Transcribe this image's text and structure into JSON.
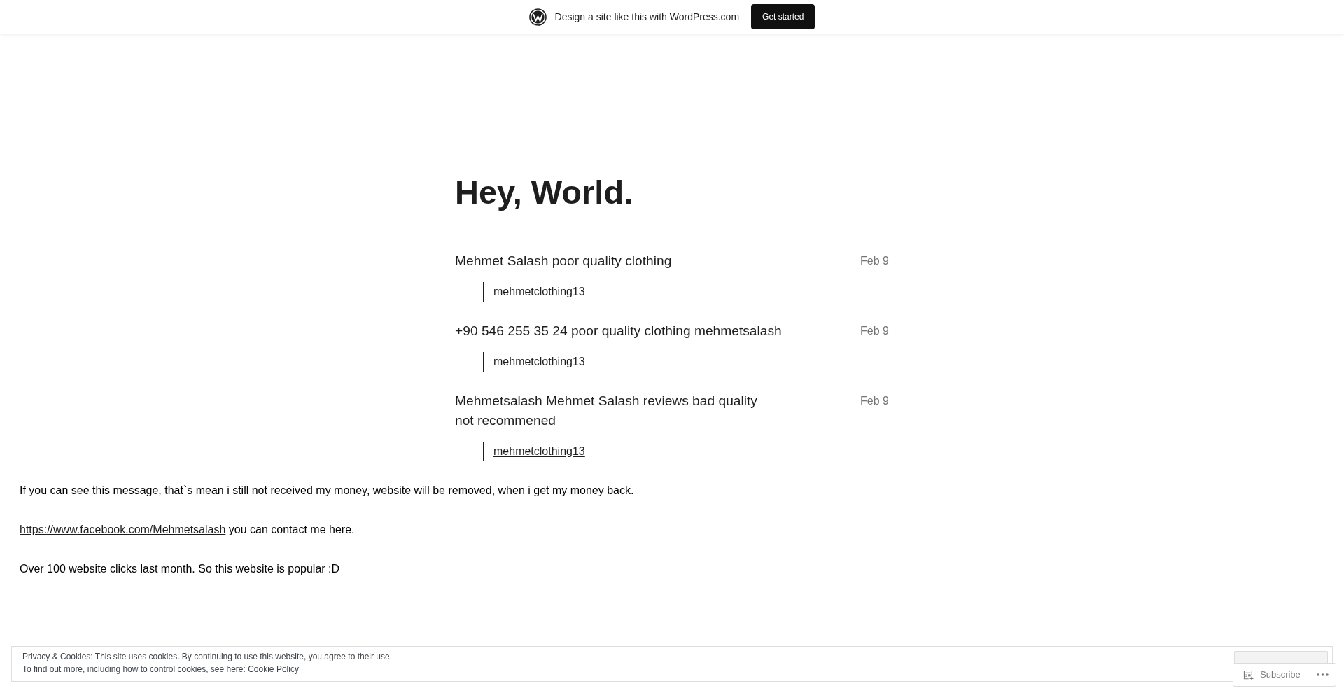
{
  "top_banner": {
    "text": "Design a site like this with WordPress.com",
    "button": "Get started"
  },
  "page_title": "Hey, World.",
  "posts": [
    {
      "title": "Mehmet Salash poor quality clothing",
      "date": "Feb 9",
      "link": "mehmetclothing13"
    },
    {
      "title": "+90 546 255 35 24 poor quality clothing mehmetsalash",
      "date": "Feb 9",
      "link": "mehmetclothing13"
    },
    {
      "title": "Mehmetsalash Mehmet Salash reviews bad quality not recommened",
      "date": "Feb 9",
      "link": "mehmetclothing13"
    }
  ],
  "notes": [
    {
      "parts": [
        {
          "kind": "text",
          "text": "If you can see this message, that`s mean i still not received my money, website will be removed, when i get my money back."
        }
      ]
    },
    {
      "parts": [
        {
          "kind": "link",
          "text": "https://www.facebook.com/Mehmetsalash"
        },
        {
          "kind": "text",
          "text": "you can contact me here."
        }
      ]
    },
    {
      "parts": [
        {
          "kind": "text",
          "text": "Over 100 website clicks last month. So this website is popular :D"
        }
      ]
    }
  ],
  "cookie_banner": {
    "lines": [
      {
        "parts": [
          {
            "kind": "text",
            "text": "Privacy & Cookies: This site uses cookies. By continuing to use this website, you agree to their use."
          }
        ]
      },
      {
        "parts": [
          {
            "kind": "text",
            "text": "To find out more, including how to control cookies, see here:"
          },
          {
            "kind": "link",
            "text": "Cookie Policy"
          }
        ]
      }
    ]
  },
  "action_bar": {
    "subscribe": "Subscribe"
  }
}
